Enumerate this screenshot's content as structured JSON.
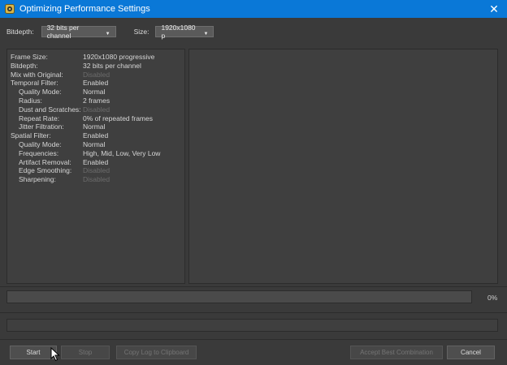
{
  "window": {
    "title": "Optimizing Performance Settings",
    "close_glyph": "✕",
    "title_bar_color": "#0a78d7",
    "app_icon": "app-icon"
  },
  "toolbar": {
    "bitdepth_label": "Bitdepth:",
    "bitdepth_value": "32 bits per channel",
    "size_label": "Size:",
    "size_value": "1920x1080 p"
  },
  "settings": [
    {
      "label": "Frame Size:",
      "value": "1920x1080 progressive",
      "indent": 0,
      "disabled": false
    },
    {
      "label": "Bitdepth:",
      "value": "32 bits per channel",
      "indent": 0,
      "disabled": false
    },
    {
      "label": "Mix with Original:",
      "value": "Disabled",
      "indent": 0,
      "disabled": true
    },
    {
      "label": "Temporal Filter:",
      "value": "Enabled",
      "indent": 0,
      "disabled": false
    },
    {
      "label": "Quality Mode:",
      "value": "Normal",
      "indent": 1,
      "disabled": false
    },
    {
      "label": "Radius:",
      "value": "2 frames",
      "indent": 1,
      "disabled": false
    },
    {
      "label": "Dust and Scratches:",
      "value": "Disabled",
      "indent": 1,
      "disabled": true
    },
    {
      "label": "Repeat Rate:",
      "value": "0% of repeated frames",
      "indent": 1,
      "disabled": false
    },
    {
      "label": "Jitter Filtration:",
      "value": "Normal",
      "indent": 1,
      "disabled": false
    },
    {
      "label": "Spatial Filter:",
      "value": "Enabled",
      "indent": 0,
      "disabled": false
    },
    {
      "label": "Quality Mode:",
      "value": "Normal",
      "indent": 1,
      "disabled": false
    },
    {
      "label": "Frequencies:",
      "value": "High, Mid, Low, Very Low",
      "indent": 1,
      "disabled": false
    },
    {
      "label": "Artifact Removal:",
      "value": "Enabled",
      "indent": 1,
      "disabled": false
    },
    {
      "label": "Edge Smoothing:",
      "value": "Disabled",
      "indent": 1,
      "disabled": true
    },
    {
      "label": "Sharpening:",
      "value": "Disabled",
      "indent": 1,
      "disabled": true
    }
  ],
  "progress": {
    "percent_text": "0%",
    "value": 0
  },
  "status_text": "",
  "buttons": {
    "start": "Start",
    "stop": "Stop",
    "copy_log": "Copy Log to Clipboard",
    "accept_best": "Accept Best Combination",
    "cancel": "Cancel"
  },
  "colors": {
    "accent": "#0a78d7",
    "background": "#3a3a3a",
    "disabled_text": "#6c6c6c"
  }
}
